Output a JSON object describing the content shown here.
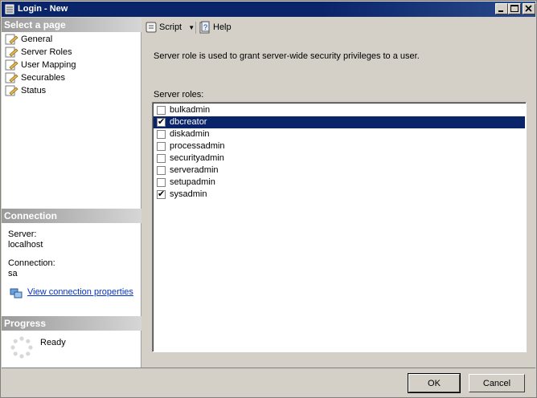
{
  "window": {
    "title": "Login - New",
    "accent": "#0a246a"
  },
  "sidebar": {
    "select_header": "Select a page",
    "items": [
      {
        "label": "General",
        "icon": "page-wrench-icon"
      },
      {
        "label": "Server Roles",
        "icon": "page-wrench-icon",
        "selected": true
      },
      {
        "label": "User Mapping",
        "icon": "page-wrench-icon"
      },
      {
        "label": "Securables",
        "icon": "page-wrench-icon"
      },
      {
        "label": "Status",
        "icon": "page-wrench-icon"
      }
    ],
    "connection_header": "Connection",
    "server_label": "Server:",
    "server_value": "localhost",
    "connection_label": "Connection:",
    "connection_value": "sa",
    "view_props_link": "View connection properties",
    "progress_header": "Progress",
    "progress_status": "Ready"
  },
  "toolbar": {
    "script_label": "Script",
    "help_label": "Help"
  },
  "main": {
    "description": "Server role is used to grant server-wide security privileges to a user.",
    "roles_label": "Server roles:",
    "roles": [
      {
        "name": "bulkadmin",
        "checked": false
      },
      {
        "name": "dbcreator",
        "checked": true,
        "selected": true
      },
      {
        "name": "diskadmin",
        "checked": false
      },
      {
        "name": "processadmin",
        "checked": false
      },
      {
        "name": "securityadmin",
        "checked": false
      },
      {
        "name": "serveradmin",
        "checked": false
      },
      {
        "name": "setupadmin",
        "checked": false
      },
      {
        "name": "sysadmin",
        "checked": true
      }
    ]
  },
  "footer": {
    "ok_label": "OK",
    "cancel_label": "Cancel"
  }
}
